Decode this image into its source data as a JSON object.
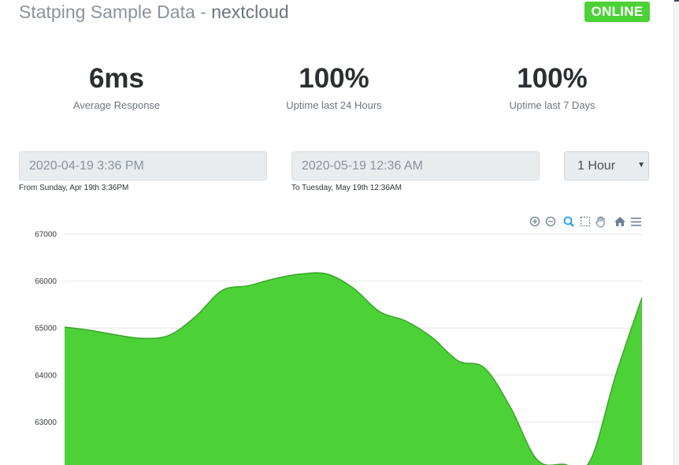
{
  "header": {
    "title_prefix": "Statping Sample Data",
    "separator": "-",
    "service_name": "nextcloud",
    "status_badge": "ONLINE",
    "status_color": "#4cd137"
  },
  "stats": [
    {
      "value": "6ms",
      "label": "Average Response"
    },
    {
      "value": "100%",
      "label": "Uptime last 24 Hours"
    },
    {
      "value": "100%",
      "label": "Uptime last 7 Days"
    }
  ],
  "filters": {
    "start_value": "2020-04-19 3:36 PM",
    "start_caption": "From Sunday, Apr 19th 3:36PM",
    "end_value": "2020-05-19 12:36 AM",
    "end_caption": "To Tuesday, May 19th 12:36AM",
    "interval_selected": "1 Hour"
  },
  "toolbar": {
    "icons": [
      "zoom-in-icon",
      "zoom-out-icon",
      "selection-zoom-icon",
      "selection-icon",
      "pan-icon",
      "reset-zoom-icon",
      "menu-icon"
    ]
  },
  "chart_data": {
    "type": "area",
    "title": "",
    "xlabel": "",
    "ylabel": "",
    "color": "#4cd137",
    "y_ticks": [
      67000,
      66000,
      65000,
      64000,
      63000
    ],
    "ylim": [
      62100,
      67000
    ],
    "grid": true,
    "series": [
      {
        "values": [
          65020,
          64950,
          64850,
          64780,
          64850,
          65250,
          65800,
          65900,
          66050,
          66150,
          66150,
          65850,
          65350,
          65150,
          64800,
          64300,
          64150,
          63300,
          62200,
          62100,
          62150,
          64000,
          65650
        ]
      }
    ]
  }
}
